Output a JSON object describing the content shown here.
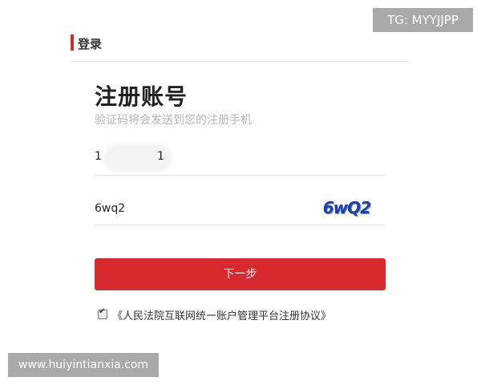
{
  "badge": {
    "text": "TG: MYYJJPP"
  },
  "header": {
    "title": "登录"
  },
  "form": {
    "title": "注册账号",
    "subtitle": "验证码将会发送到您的注册手机",
    "phone": {
      "prefix": "1",
      "suffix": "1"
    },
    "captcha": {
      "value": "6wq2",
      "image_text": "6wQ2"
    },
    "next_label": "下一步",
    "agreement": "《人民法院互联网统一账户管理平台注册协议》",
    "agreement_checked": true
  },
  "watermark": {
    "text": "www.huiyintianxia.com"
  },
  "colors": {
    "accent": "#d7292e",
    "captcha": "#1f3fa8"
  }
}
